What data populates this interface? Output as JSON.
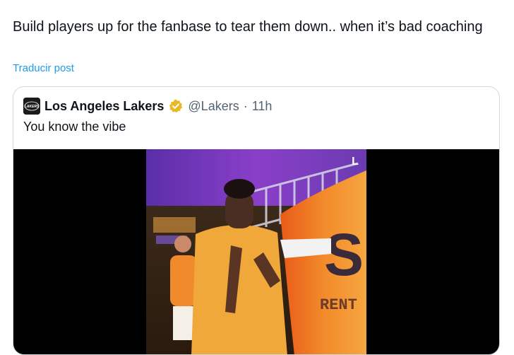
{
  "tweet": {
    "text": "Build players up for the fanbase to tear them down.. when it’s bad coaching",
    "translate_label": "Traducir post"
  },
  "quote": {
    "author_name": "Los Angeles Lakers",
    "handle": "@Lakers",
    "separator": "·",
    "time": "11h",
    "text": "You know the vibe",
    "verified_color": "#e8b923",
    "avatar_text": "LAKERS"
  },
  "video": {
    "banner_letter": "S",
    "banner_text": "RENT",
    "corner_logo": "L"
  }
}
